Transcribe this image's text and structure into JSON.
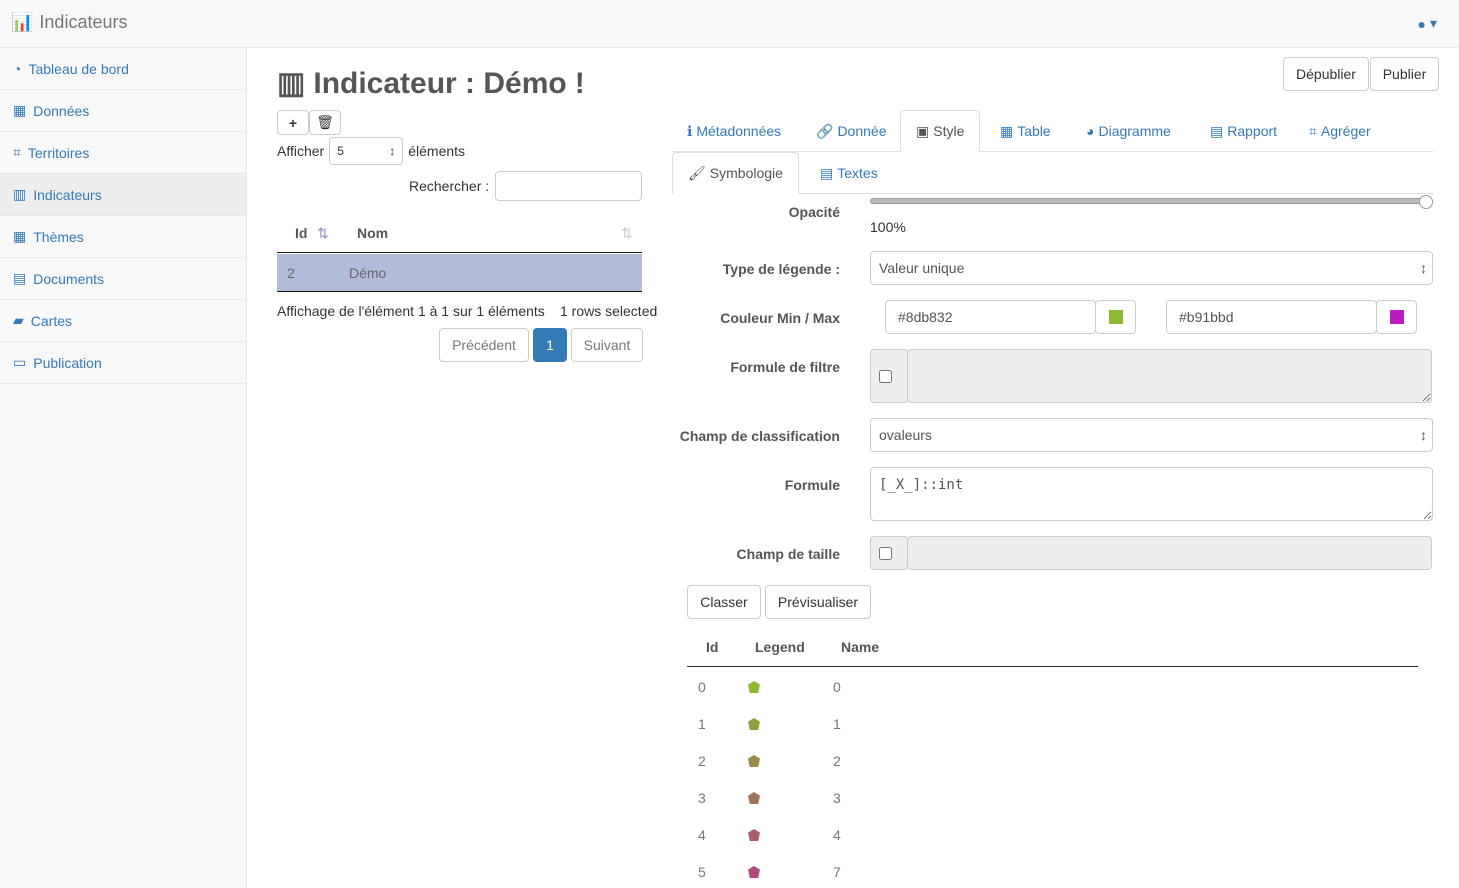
{
  "app": {
    "title": "Indicateurs"
  },
  "sidebar": {
    "items": [
      {
        "label": "Tableau de bord",
        "icon": "dashboard-icon"
      },
      {
        "label": "Données",
        "icon": "cubes-icon"
      },
      {
        "label": "Territoires",
        "icon": "sitemap-icon"
      },
      {
        "label": "Indicateurs",
        "icon": "bar-chart-icon"
      },
      {
        "label": "Thèmes",
        "icon": "grid-icon"
      },
      {
        "label": "Documents",
        "icon": "document-icon"
      },
      {
        "label": "Cartes",
        "icon": "map-icon"
      },
      {
        "label": "Publication",
        "icon": "laptop-icon"
      }
    ]
  },
  "page": {
    "title": "Indicateur : Démo",
    "depublish": "Dépublier",
    "publish": "Publier"
  },
  "list": {
    "show_label": "Afficher",
    "show_value": "5",
    "show_suffix": "éléments",
    "search_label": "Rechercher :",
    "columns": [
      "Id",
      "Nom"
    ],
    "rows": [
      {
        "id": "2",
        "name": "Démo"
      }
    ],
    "info": "Affichage de l'élément 1 à 1 sur 1 éléments",
    "selected": "1 rows selected",
    "prev": "Précédent",
    "page": "1",
    "next": "Suivant"
  },
  "tabs": [
    "Métadonnées",
    "Donnée",
    "Style",
    "Table",
    "Diagramme",
    "Rapport",
    "Agréger"
  ],
  "subtabs": [
    "Symbologie",
    "Textes"
  ],
  "style": {
    "opacity_label": "Opacité",
    "opacity_value": "100%",
    "legend_type_label": "Type de légende :",
    "legend_type": "Valeur unique",
    "color_label": "Couleur Min / Max",
    "color_min": "#8db832",
    "color_max": "#b91bbd",
    "filter_label": "Formule de filtre",
    "class_field_label": "Champ de classification",
    "class_field": "ovaleurs",
    "formula_label": "Formule",
    "formula": "[_X_]::int",
    "size_field_label": "Champ de taille",
    "classify": "Classer",
    "preview": "Prévisualiser"
  },
  "legend_table": {
    "columns": [
      "Id",
      "Legend",
      "Name"
    ],
    "rows": [
      {
        "id": "0",
        "color": "#8db832",
        "name": "0"
      },
      {
        "id": "1",
        "color": "#92a03e",
        "name": "1"
      },
      {
        "id": "2",
        "color": "#978a4c",
        "name": "2"
      },
      {
        "id": "3",
        "color": "#9e7558",
        "name": "3"
      },
      {
        "id": "4",
        "color": "#a5606c",
        "name": "4"
      },
      {
        "id": "5",
        "color": "#ad4b80",
        "name": "7"
      }
    ]
  }
}
